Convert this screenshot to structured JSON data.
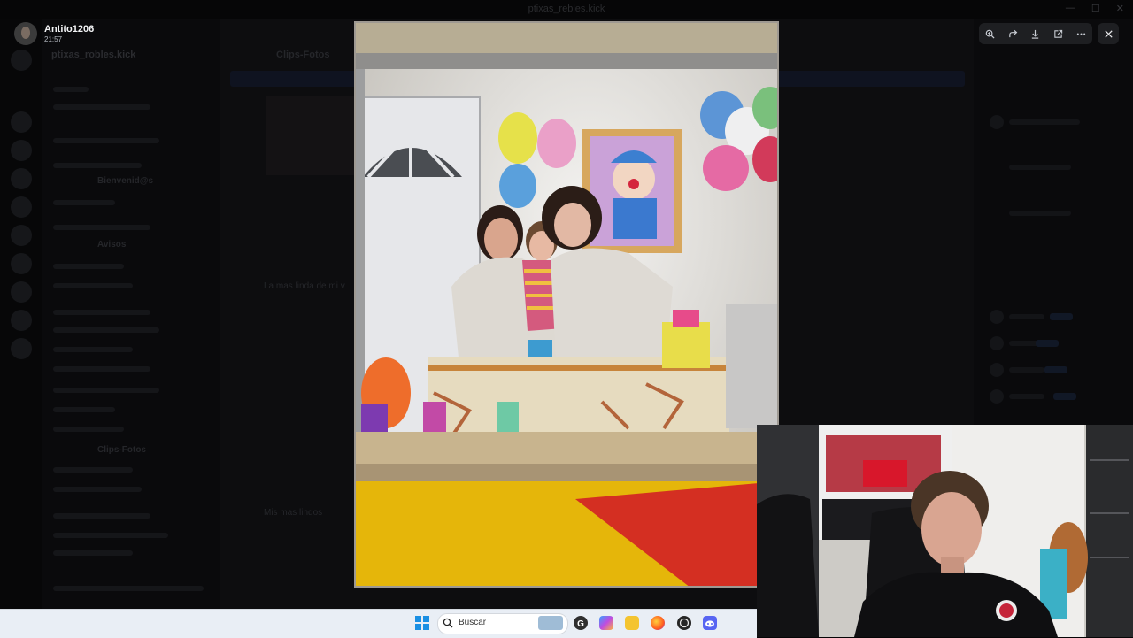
{
  "window": {
    "title": "ptixas_rebles.kick"
  },
  "server": {
    "name": "ptixas_robles.kick"
  },
  "channels": {
    "highlighted_1": "Bienvenid@s",
    "highlighted_2": "Avisos",
    "current": "Clips-Fotos"
  },
  "chat": {
    "header": "Clips-Fotos",
    "message_1": "La mas linda de mi v",
    "message_2": "Mis mas lindos"
  },
  "viewer": {
    "author_name": "Antito1206",
    "author_time": "21:57",
    "toolbar": [
      {
        "icon": "zoom-in-icon"
      },
      {
        "icon": "forward-icon"
      },
      {
        "icon": "download-icon"
      },
      {
        "icon": "open-external-icon"
      },
      {
        "icon": "more-icon"
      }
    ],
    "close_icon": "close-icon"
  },
  "taskbar": {
    "search_label": "Buscar",
    "apps": [
      "start-icon",
      "search-icon",
      "google-icon",
      "copilot-icon",
      "file-explorer-icon",
      "firefox-icon",
      "obs-icon",
      "discord-icon"
    ]
  },
  "colors": {
    "overlay": "#050506",
    "toolbar_bg": "#1e1f22",
    "taskbar_bg": "#e9eef5",
    "discord_blurple": "#5865f2"
  }
}
